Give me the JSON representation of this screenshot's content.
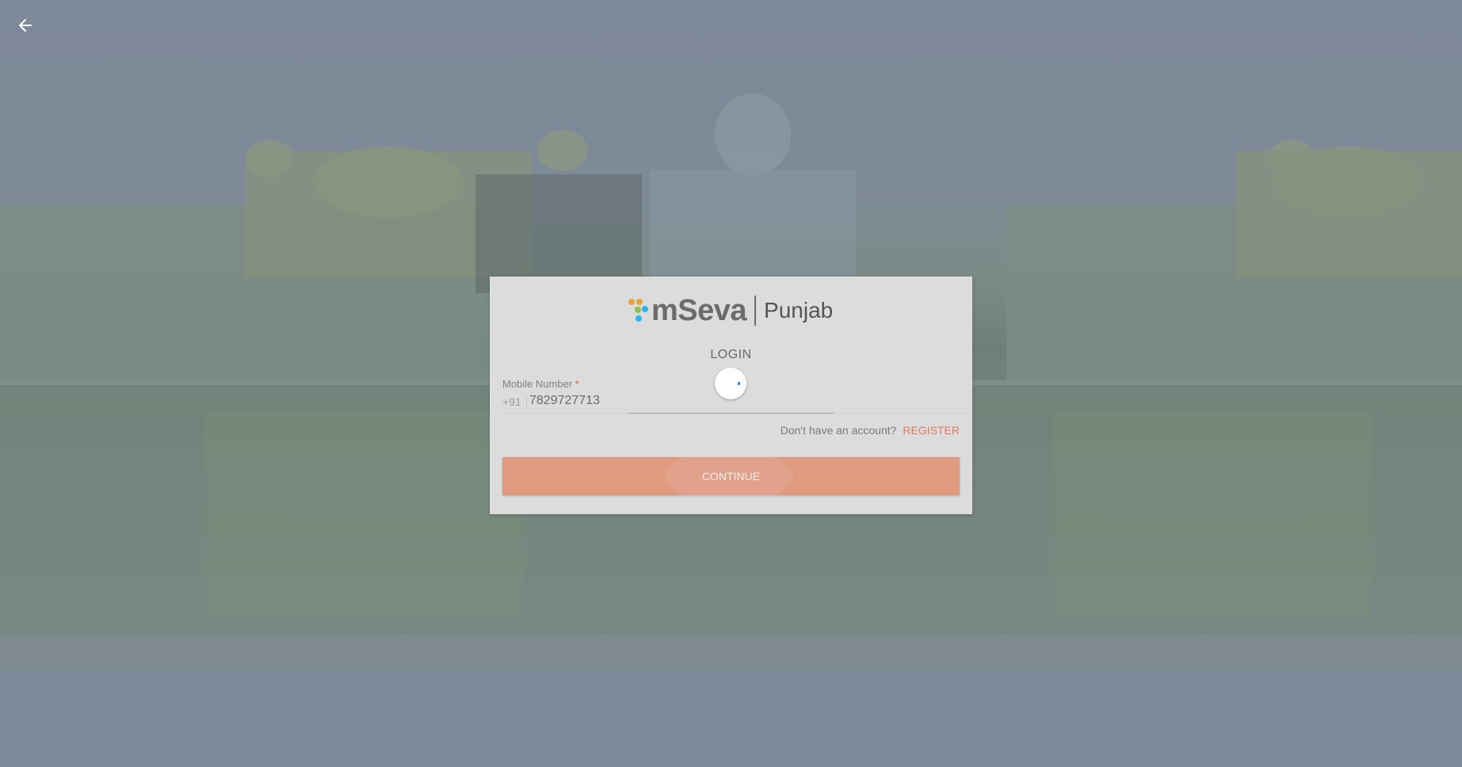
{
  "nav": {
    "back_icon": "arrow-left-icon"
  },
  "logo": {
    "brand": "mSeva",
    "region": "Punjab",
    "dot_colors": [
      "#e9a33a",
      "#e9a33a",
      "#8bc34a",
      "#29b6f6"
    ]
  },
  "login": {
    "title": "LOGIN",
    "mobile_label": "Mobile Number",
    "required_marker": "*",
    "country_code": "+91",
    "mobile_value": "7829727713",
    "no_account_text": "Don't have an account?",
    "register_label": "REGISTER",
    "continue_label": "CONTINUE",
    "loading": true
  },
  "colors": {
    "accent": "#e07a5f",
    "button": "#e09a80",
    "spinner": "#1e88e5",
    "card": "#dcdcdc",
    "overlay": "#7f8b99"
  }
}
